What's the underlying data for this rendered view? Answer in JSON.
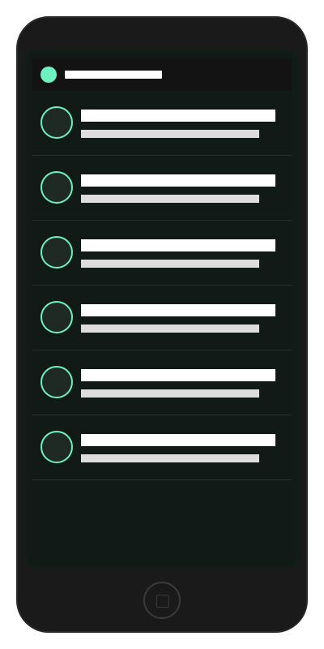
{
  "colors": {
    "accent": "#6ef0c0",
    "phone_body": "#1a1a1a",
    "screen_bg": "#111a16",
    "skeleton_primary": "#ffffff",
    "skeleton_secondary": "#dddddd"
  },
  "header": {
    "title": "",
    "status_indicator": "green-dot"
  },
  "list": {
    "items": [
      {
        "title": "",
        "subtitle": ""
      },
      {
        "title": "",
        "subtitle": ""
      },
      {
        "title": "",
        "subtitle": ""
      },
      {
        "title": "",
        "subtitle": ""
      },
      {
        "title": "",
        "subtitle": ""
      },
      {
        "title": "",
        "subtitle": ""
      }
    ]
  },
  "device": {
    "home_button_icon": "square-icon"
  }
}
